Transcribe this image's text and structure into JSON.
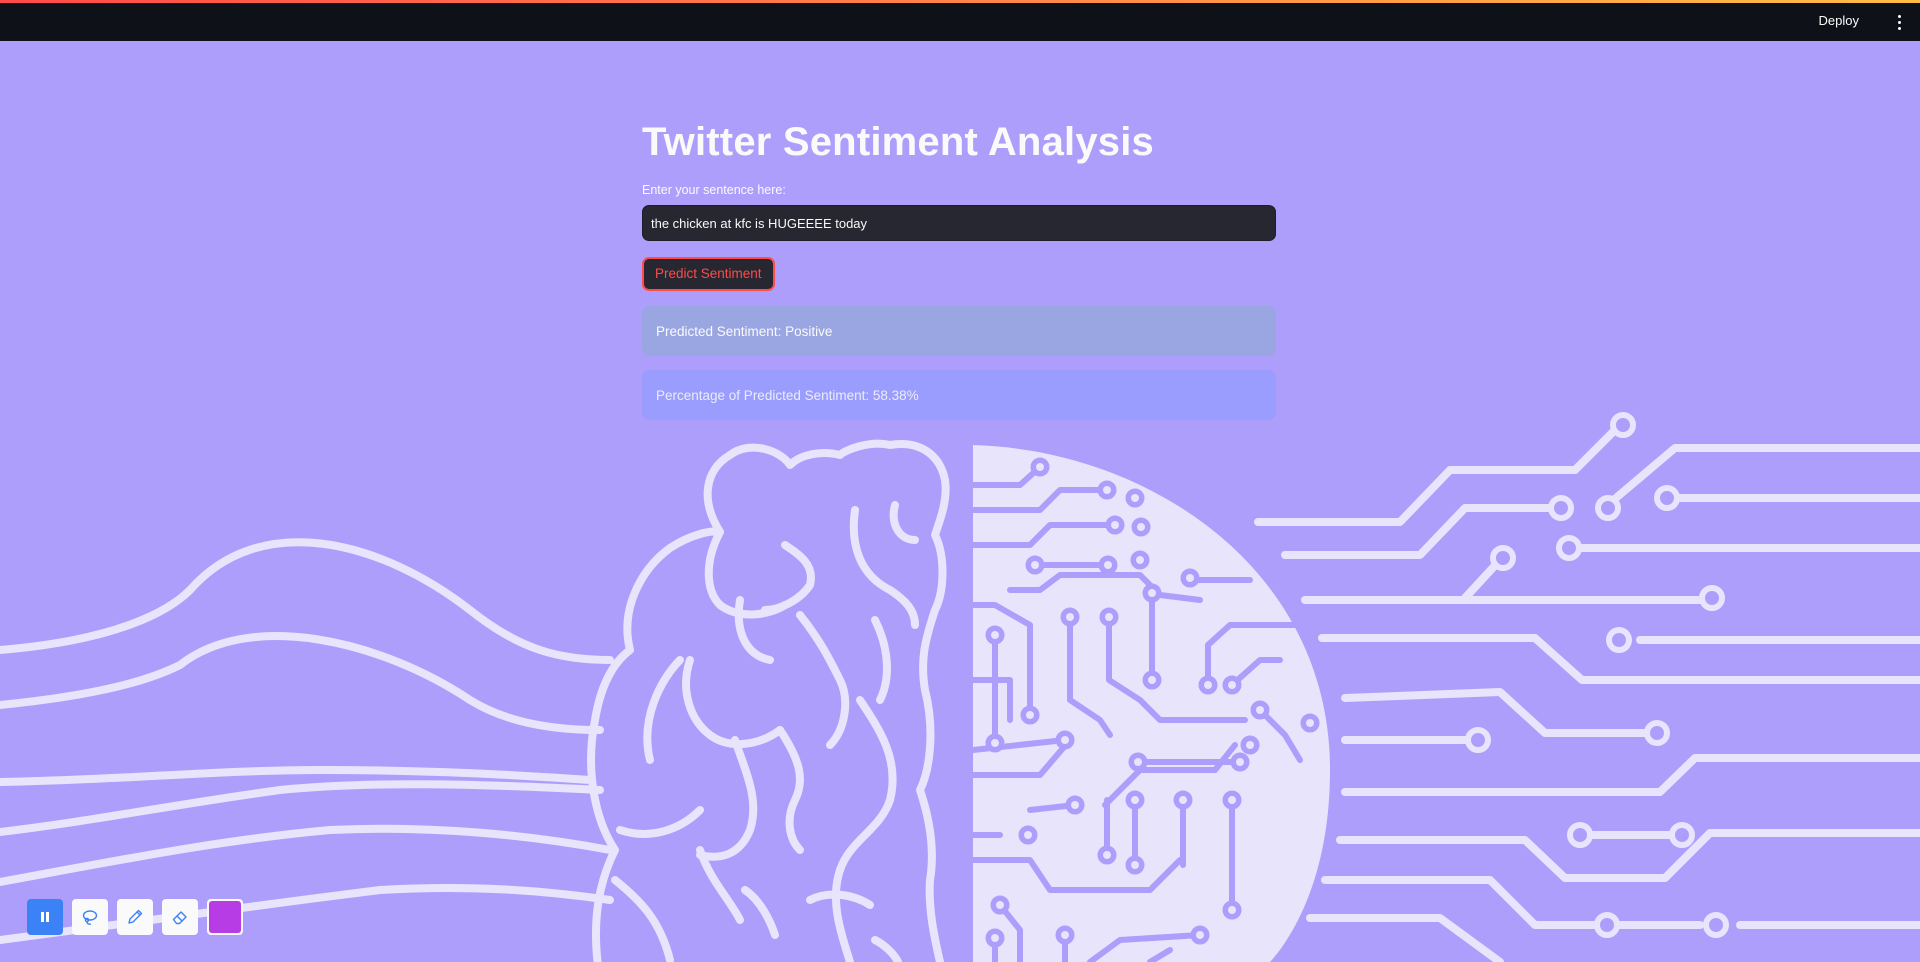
{
  "header": {
    "deploy_label": "Deploy",
    "menu_icon": "kebab-menu-icon"
  },
  "main": {
    "title": "Twitter Sentiment Analysis",
    "input_label": "Enter your sentence here:",
    "input_value": "the chicken at kfc is HUGEEEE today",
    "predict_button": "Predict Sentiment",
    "prediction_text": "Predicted Sentiment: Positive",
    "percentage_text": "Percentage of Predicted Sentiment: 58.38%"
  },
  "toolbar": {
    "tools": [
      "pause-icon",
      "lasso-icon",
      "pen-icon",
      "eraser-icon",
      "color-swatch"
    ],
    "swatch_color": "#b83ce6"
  },
  "colors": {
    "background": "#ae9efc",
    "header": "#0e1117",
    "accent": "#ff4b4b",
    "illustration_stroke": "#e8e4fb"
  }
}
